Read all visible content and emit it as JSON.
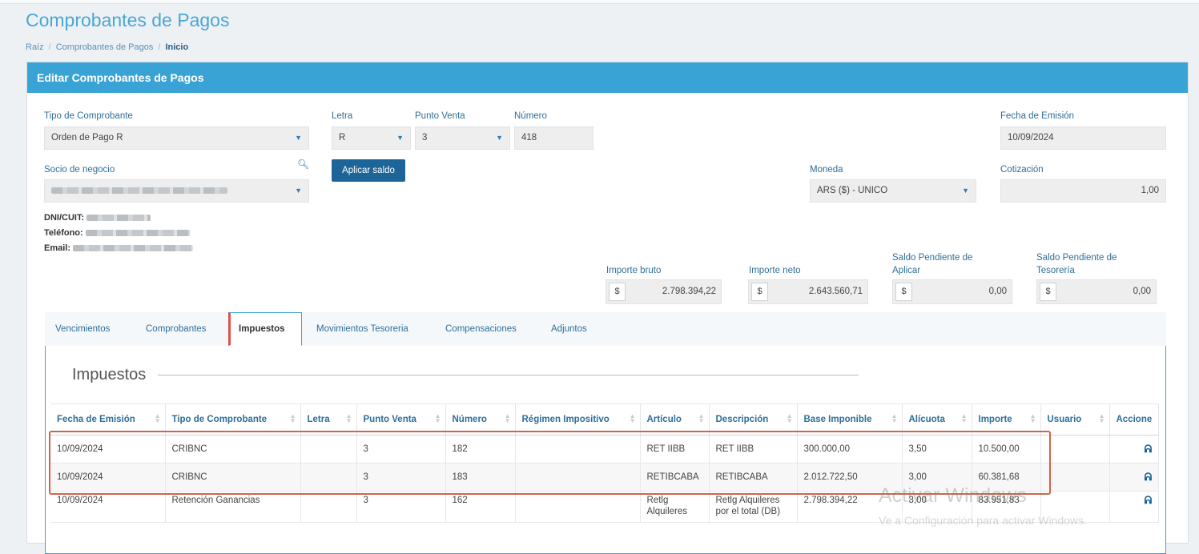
{
  "page": {
    "title": "Comprobantes de Pagos"
  },
  "breadcrumb": {
    "root": "Raíz",
    "section": "Comprobantes de Pagos",
    "current": "Inicio",
    "separator": "/"
  },
  "panel": {
    "title": "Editar Comprobantes de Pagos"
  },
  "form": {
    "tipo_label": "Tipo de Comprobante",
    "tipo_value": "Orden de Pago R",
    "letra_label": "Letra",
    "letra_value": "R",
    "punto_label": "Punto Venta",
    "punto_value": "3",
    "numero_label": "Número",
    "numero_value": "418",
    "fecha_label": "Fecha de Emisión",
    "fecha_value": "10/09/2024",
    "socio_label": "Socio de negocio",
    "aplicar_label": "Aplicar saldo",
    "moneda_label": "Moneda",
    "moneda_value": "ARS ($) - UNICO",
    "cotizacion_label": "Cotización",
    "cotizacion_value": "1,00",
    "dni_label": "DNI/CUIT:",
    "tel_label": "Teléfono:",
    "email_label": "Email:"
  },
  "totals": {
    "currency": "$",
    "bruto_label": "Importe bruto",
    "bruto_value": "2.798.394,22",
    "neto_label": "Importe neto",
    "neto_value": "2.643.560,71",
    "pend_aplicar_label_1": "Saldo Pendiente de",
    "pend_aplicar_label_2": "Aplicar",
    "pend_aplicar_value": "0,00",
    "pend_tesoreria_label_1": "Saldo Pendiente de",
    "pend_tesoreria_label_2": "Tesorería",
    "pend_tesoreria_value": "0,00"
  },
  "tabs": [
    "Vencimientos",
    "Comprobantes",
    "Impuestos",
    "Movimientos Tesoreria",
    "Compensaciones",
    "Adjuntos"
  ],
  "impuestos": {
    "legend": "Impuestos",
    "columns": [
      "Fecha de Emisión",
      "Tipo de Comprobante",
      "Letra",
      "Punto Venta",
      "Número",
      "Régimen Impositivo",
      "Artículo",
      "Descripción",
      "Base Imponible",
      "Alícuota",
      "Importe",
      "Usuario",
      "Accione"
    ],
    "rows": [
      [
        "10/09/2024",
        "CRIBNC",
        "",
        "3",
        "182",
        "",
        "RET IIBB",
        "RET IIBB",
        "300.000,00",
        "3,50",
        "10.500,00",
        ""
      ],
      [
        "10/09/2024",
        "CRIBNC",
        "",
        "3",
        "183",
        "",
        "RETIBCABA",
        "RETIBCABA",
        "2.012.722,50",
        "3,00",
        "60.381,68",
        ""
      ],
      [
        "10/09/2024",
        "Retención Ganancias",
        "",
        "3",
        "162",
        "",
        "Retlg Alquileres",
        "Retlg Alquileres por el total (DB)",
        "2.798.394,22",
        "3,00",
        "83.951,83",
        ""
      ]
    ]
  },
  "watermark": {
    "line1": "Activar Windows",
    "line2": "Ve a Configuración para activar Windows."
  }
}
